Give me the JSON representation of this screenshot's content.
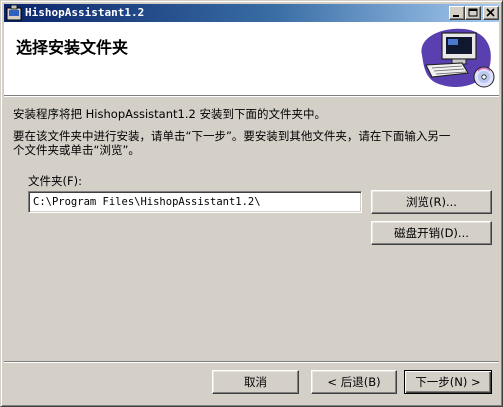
{
  "window": {
    "title": "HishopAssistant1.2"
  },
  "header": {
    "title": "选择安装文件夹"
  },
  "content": {
    "line1": "安装程序将把 HishopAssistant1.2 安装到下面的文件夹中。",
    "line2": "要在该文件夹中进行安装，请单击“下一步”。要安装到其他文件夹，请在下面输入另一",
    "line3": "个文件夹或单击“浏览”。",
    "folder_label": "文件夹(F):",
    "folder_value": "C:\\Program Files\\HishopAssistant1.2\\"
  },
  "buttons": {
    "browse": "浏览(R)...",
    "disk_cost": "磁盘开销(D)...",
    "cancel": "取消",
    "back": "< 后退(B)",
    "next": "下一步(N) >"
  },
  "icons": {
    "app": "installer-icon",
    "header_art": "computer-cd-icon",
    "minimize": "minimize-icon",
    "maximize": "maximize-icon",
    "close": "close-icon"
  }
}
